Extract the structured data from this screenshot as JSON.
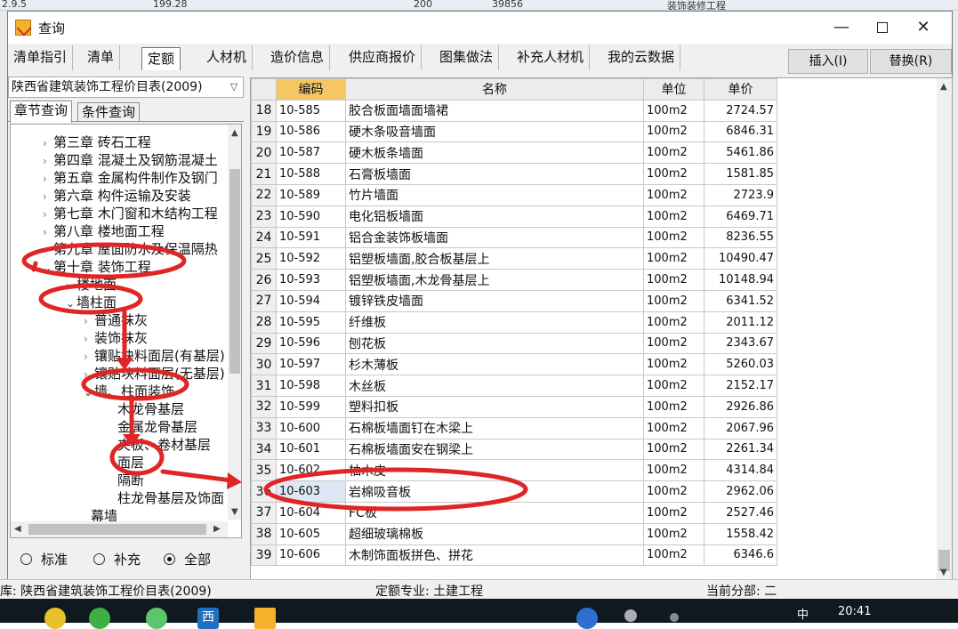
{
  "background": {
    "top_values": [
      "2.9.5",
      "199.28",
      "200",
      "39856"
    ],
    "top_text": "装饰装修工程"
  },
  "window": {
    "title": "查询",
    "minimize": "—",
    "close": "✕"
  },
  "tabs": [
    "清单指引",
    "清单",
    "定额",
    "人材机",
    "造价信息",
    "供应商报价",
    "图集做法",
    "补充人材机",
    "我的云数据"
  ],
  "active_tab": "定额",
  "buttons": {
    "insert": "插入(I)",
    "replace": "替换(R)"
  },
  "library": "陕西省建筑装饰工程价目表(2009)",
  "subtabs": [
    "章节查询",
    "条件查询"
  ],
  "tree": [
    {
      "label": "第三章 砖石工程",
      "arrow": "›"
    },
    {
      "label": "第四章 混凝土及钢筋混凝土",
      "arrow": "›"
    },
    {
      "label": "第五章 金属构件制作及钢门",
      "arrow": "›"
    },
    {
      "label": "第六章 构件运输及安装",
      "arrow": "›"
    },
    {
      "label": "第七章 木门窗和木结构工程",
      "arrow": "›"
    },
    {
      "label": "第八章 楼地面工程",
      "arrow": "›"
    },
    {
      "label": "第九章 屋面防水及保温隔热",
      "arrow": "›"
    },
    {
      "label": "第十章 装饰工程",
      "arrow": "⌄"
    },
    {
      "label": "楼地面",
      "arrow": "›"
    },
    {
      "label": "墙柱面",
      "arrow": "⌄"
    },
    {
      "label": "普通抹灰",
      "arrow": "›"
    },
    {
      "label": "装饰抹灰",
      "arrow": "›"
    },
    {
      "label": "镶贴块料面层(有基层)",
      "arrow": "›"
    },
    {
      "label": "镶贴块料面层(无基层)",
      "arrow": "›"
    },
    {
      "label": "墙、柱面装饰",
      "arrow": "⌄"
    },
    {
      "label": "木龙骨基层",
      "arrow": ""
    },
    {
      "label": "金属龙骨基层",
      "arrow": ""
    },
    {
      "label": "夹板、卷材基层",
      "arrow": ""
    },
    {
      "label": "面层",
      "arrow": ""
    },
    {
      "label": "隔断",
      "arrow": ""
    },
    {
      "label": "柱龙骨基层及饰面",
      "arrow": ""
    },
    {
      "label": "幕墙",
      "arrow": ""
    }
  ],
  "radio_options": [
    "标准",
    "补充",
    "全部"
  ],
  "radio_selected": "全部",
  "grid": {
    "columns": [
      "编码",
      "名称",
      "单位",
      "单价"
    ],
    "rows": [
      {
        "n": "18",
        "code": "10-585",
        "name": "胶合板面墙面墙裙",
        "unit": "100m2",
        "price": "2724.57"
      },
      {
        "n": "19",
        "code": "10-586",
        "name": "硬木条吸音墙面",
        "unit": "100m2",
        "price": "6846.31"
      },
      {
        "n": "20",
        "code": "10-587",
        "name": "硬木板条墙面",
        "unit": "100m2",
        "price": "5461.86"
      },
      {
        "n": "21",
        "code": "10-588",
        "name": "石膏板墙面",
        "unit": "100m2",
        "price": "1581.85"
      },
      {
        "n": "22",
        "code": "10-589",
        "name": "竹片墙面",
        "unit": "100m2",
        "price": "2723.9"
      },
      {
        "n": "23",
        "code": "10-590",
        "name": "电化铝板墙面",
        "unit": "100m2",
        "price": "6469.71"
      },
      {
        "n": "24",
        "code": "10-591",
        "name": "铝合金装饰板墙面",
        "unit": "100m2",
        "price": "8236.55"
      },
      {
        "n": "25",
        "code": "10-592",
        "name": "铝塑板墙面,胶合板基层上",
        "unit": "100m2",
        "price": "10490.47"
      },
      {
        "n": "26",
        "code": "10-593",
        "name": "铝塑板墙面,木龙骨基层上",
        "unit": "100m2",
        "price": "10148.94"
      },
      {
        "n": "27",
        "code": "10-594",
        "name": "镀锌铁皮墙面",
        "unit": "100m2",
        "price": "6341.52"
      },
      {
        "n": "28",
        "code": "10-595",
        "name": "纤维板",
        "unit": "100m2",
        "price": "2011.12"
      },
      {
        "n": "29",
        "code": "10-596",
        "name": "刨花板",
        "unit": "100m2",
        "price": "2343.67"
      },
      {
        "n": "30",
        "code": "10-597",
        "name": "杉木薄板",
        "unit": "100m2",
        "price": "5260.03"
      },
      {
        "n": "31",
        "code": "10-598",
        "name": "木丝板",
        "unit": "100m2",
        "price": "2152.17"
      },
      {
        "n": "32",
        "code": "10-599",
        "name": "塑料扣板",
        "unit": "100m2",
        "price": "2926.86"
      },
      {
        "n": "33",
        "code": "10-600",
        "name": "石棉板墙面钉在木梁上",
        "unit": "100m2",
        "price": "2067.96"
      },
      {
        "n": "34",
        "code": "10-601",
        "name": "石棉板墙面安在钢梁上",
        "unit": "100m2",
        "price": "2261.34"
      },
      {
        "n": "35",
        "code": "10-602",
        "name": "柚木皮",
        "unit": "100m2",
        "price": "4314.84"
      },
      {
        "n": "36",
        "code": "10-603",
        "name": "岩棉吸音板",
        "unit": "100m2",
        "price": "2962.06"
      },
      {
        "n": "37",
        "code": "10-604",
        "name": "FC板",
        "unit": "100m2",
        "price": "2527.46"
      },
      {
        "n": "38",
        "code": "10-605",
        "name": "超细玻璃棉板",
        "unit": "100m2",
        "price": "1558.42"
      },
      {
        "n": "39",
        "code": "10-606",
        "name": "木制饰面板拼色、拼花",
        "unit": "100m2",
        "price": "6346.6"
      }
    ],
    "selected_row": "36"
  },
  "status": {
    "left": "库: 陕西省建筑装饰工程价目表(2009)",
    "middle": "定额专业: 土建工程",
    "right": "当前分部: 二"
  },
  "taskbar": {
    "time": "20:41",
    "ime": "中",
    "icon_label": "西"
  },
  "colors": {
    "accent_header": "#f6c664",
    "annotation_red": "#e02525",
    "selection": "#dde8f5"
  }
}
